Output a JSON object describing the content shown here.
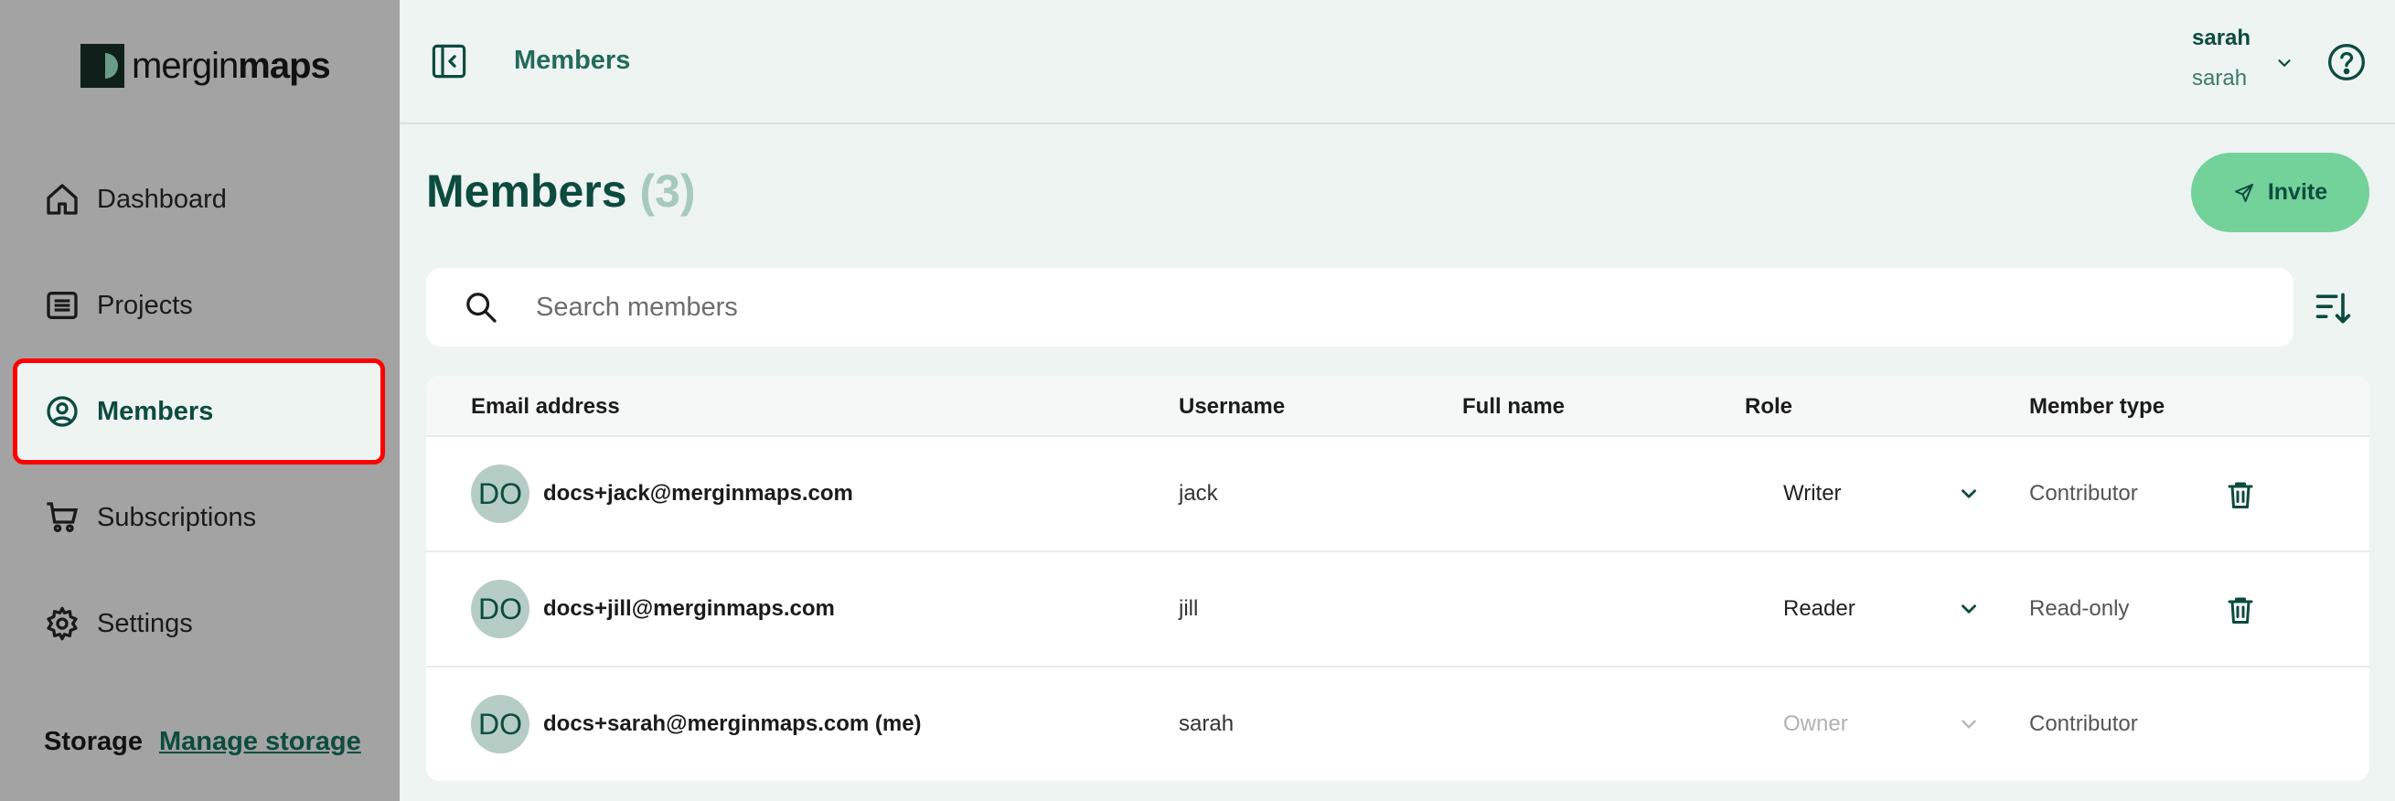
{
  "logo": {
    "light": "mergin",
    "bold": "maps"
  },
  "sidebar": {
    "items": [
      {
        "label": "Dashboard",
        "icon": "home-icon"
      },
      {
        "label": "Projects",
        "icon": "list-icon"
      },
      {
        "label": "Members",
        "icon": "user-circle-icon",
        "active": true
      },
      {
        "label": "Subscriptions",
        "icon": "cart-icon"
      },
      {
        "label": "Settings",
        "icon": "gear-icon"
      }
    ],
    "storage_label": "Storage",
    "storage_link": "Manage storage"
  },
  "header": {
    "title": "Members",
    "user_name": "sarah",
    "user_sub": "sarah"
  },
  "main": {
    "title": "Members",
    "count": "(3)",
    "invite_label": "Invite",
    "search_placeholder": "Search members"
  },
  "table": {
    "columns": [
      "Email address",
      "Username",
      "Full name",
      "Role",
      "Member type"
    ],
    "rows": [
      {
        "avatar": "DO",
        "email": "docs+jack@merginmaps.com",
        "username": "jack",
        "full_name": "",
        "role": "Writer",
        "member_type": "Contributor"
      },
      {
        "avatar": "DO",
        "email": "docs+jill@merginmaps.com",
        "username": "jill",
        "full_name": "",
        "role": "Reader",
        "member_type": "Read-only"
      },
      {
        "avatar": "DO",
        "email": "docs+sarah@merginmaps.com (me)",
        "username": "sarah",
        "full_name": "",
        "role": "Owner",
        "member_type": "Contributor"
      }
    ]
  },
  "colors": {
    "brand_dark": "#0d4b3f",
    "accent_green": "#73d19a",
    "active_border": "#ff0000"
  }
}
